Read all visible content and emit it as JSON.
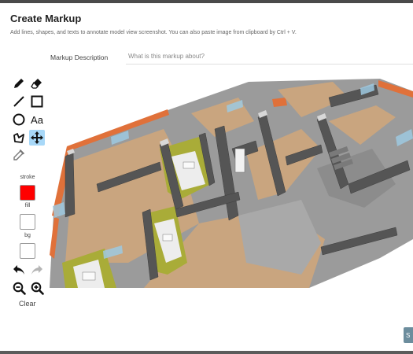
{
  "dialog": {
    "title": "Create Markup",
    "subtitle": "Add lines, shapes, and texts to annotate model view screenshot. You can also paste image from clipboard by Ctrl + V."
  },
  "description": {
    "label": "Markup Description",
    "placeholder": "What is this markup about?"
  },
  "tools": {
    "text_label": "Aa",
    "active_tool": "move"
  },
  "swatches": {
    "stroke_label": "stroke",
    "fill_label": "fill",
    "bg_label": "bg",
    "stroke_color": "#ff0000",
    "fill_color": "#ffffff",
    "bg_color": "#ffffff"
  },
  "actions": {
    "clear_label": "Clear"
  },
  "footer": {
    "save_label_partial": "S"
  }
}
